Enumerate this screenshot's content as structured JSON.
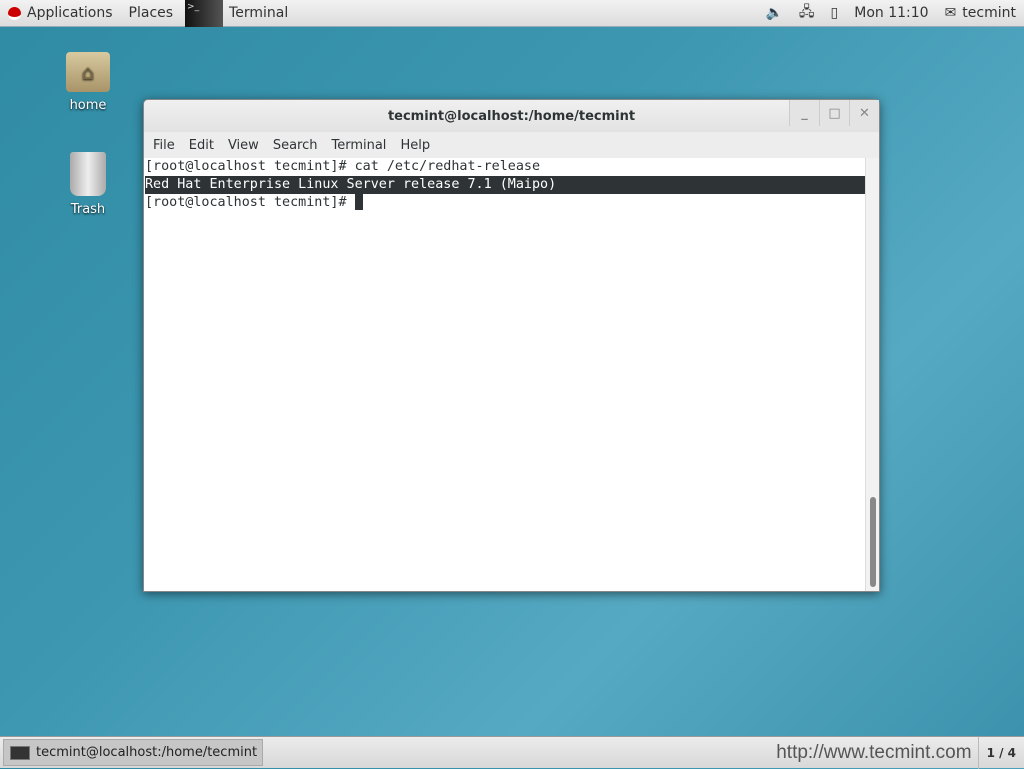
{
  "topbar": {
    "applications": "Applications",
    "places": "Places",
    "active_app": "Terminal",
    "clock": "Mon 11:10",
    "user": "tecmint"
  },
  "desktop": {
    "icons": [
      {
        "label": "home"
      },
      {
        "label": "Trash"
      }
    ]
  },
  "window": {
    "title": "tecmint@localhost:/home/tecmint",
    "menu": [
      "File",
      "Edit",
      "View",
      "Search",
      "Terminal",
      "Help"
    ],
    "lines": [
      "[root@localhost tecmint]# cat /etc/redhat-release",
      "Red Hat Enterprise Linux Server release 7.1 (Maipo)",
      "[root@localhost tecmint]# "
    ]
  },
  "taskbar": {
    "task": "tecmint@localhost:/home/tecmint",
    "watermark": "http://www.tecmint.com",
    "workspace": "1 / 4"
  }
}
